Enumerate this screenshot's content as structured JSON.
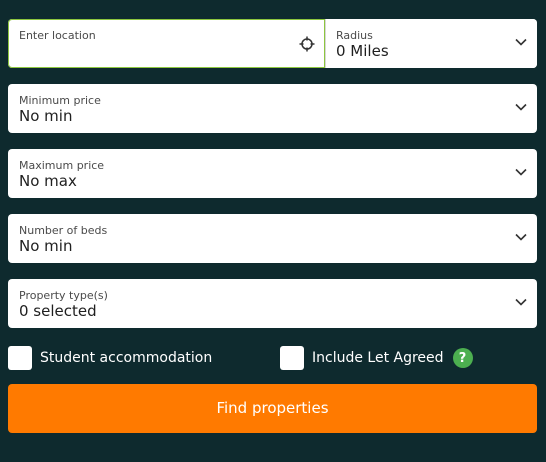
{
  "location": {
    "placeholder": "Enter location",
    "value": ""
  },
  "radius": {
    "label": "Radius",
    "value": "0 Miles"
  },
  "min_price": {
    "label": "Minimum price",
    "value": "No min"
  },
  "max_price": {
    "label": "Maximum price",
    "value": "No max"
  },
  "beds": {
    "label": "Number of beds",
    "value": "No min"
  },
  "property_type": {
    "label": "Property type(s)",
    "value": "0 selected"
  },
  "checkboxes": {
    "student": {
      "label": "Student accommodation",
      "checked": false
    },
    "let_agreed": {
      "label": "Include Let Agreed",
      "checked": false
    }
  },
  "help_glyph": "?",
  "find_button": {
    "label": "Find properties"
  },
  "colors": {
    "background": "#0e2a2e",
    "accent_orange": "#ff7a00",
    "focus_border": "#8dc63f",
    "help_green": "#4caf50"
  }
}
